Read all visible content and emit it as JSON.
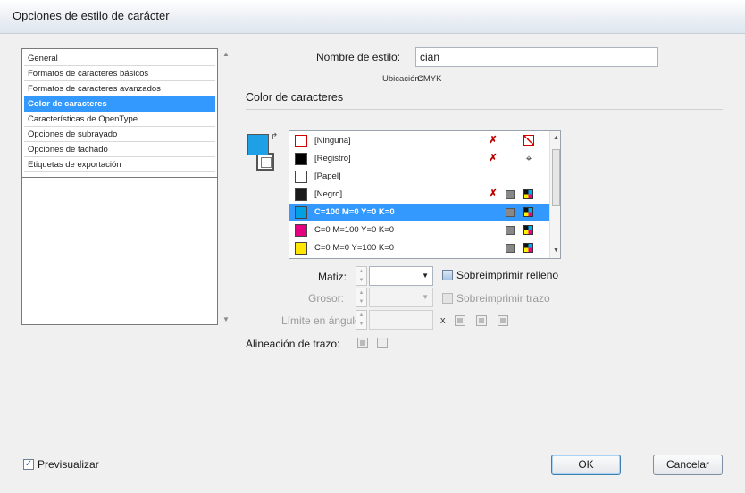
{
  "window": {
    "title": "Opciones de estilo de carácter"
  },
  "categories": [
    "General",
    "Formatos de caracteres básicos",
    "Formatos de caracteres avanzados",
    "Color de caracteres",
    "Características de OpenType",
    "Opciones de subrayado",
    "Opciones de tachado",
    "Etiquetas de exportación"
  ],
  "selected_category": "Color de caracteres",
  "style_name": {
    "label": "Nombre de estilo:",
    "value": "cian"
  },
  "location": {
    "label": "Ubicación:",
    "value": "CMYK"
  },
  "section_title": "Color de caracteres",
  "colors": {
    "fill": "#1ea0e6",
    "selection": "#3399ff"
  },
  "swatches": [
    {
      "name": "[Ninguna]",
      "color": "none",
      "icons": [
        "no-edit-icon",
        "none-icon"
      ]
    },
    {
      "name": "[Registro]",
      "color": "#000000",
      "icons": [
        "no-edit-icon",
        "registration-icon"
      ]
    },
    {
      "name": "[Papel]",
      "color": "#ffffff",
      "icons": []
    },
    {
      "name": "[Negro]",
      "color": "#1a1a1a",
      "icons": [
        "no-edit-icon",
        "process-icon",
        "cmyk-icon"
      ]
    },
    {
      "name": "C=100 M=0 Y=0 K=0",
      "color": "#00a0e3",
      "icons": [
        "process-icon",
        "cmyk-icon"
      ],
      "selected": true
    },
    {
      "name": "C=0 M=100 Y=0 K=0",
      "color": "#e4007f",
      "icons": [
        "process-icon",
        "cmyk-icon"
      ]
    },
    {
      "name": "C=0 M=0 Y=100 K=0",
      "color": "#ffe600",
      "icons": [
        "process-icon",
        "cmyk-icon"
      ]
    }
  ],
  "tint": {
    "label": "Matiz:",
    "value": ""
  },
  "weight": {
    "label": "Grosor:",
    "value": ""
  },
  "miter": {
    "label": "Límite en ángulo:",
    "value": "",
    "x_label": "x"
  },
  "overprint_fill": {
    "label": "Sobreimprimir relleno",
    "checked": false
  },
  "overprint_stroke": {
    "label": "Sobreimprimir trazo",
    "checked": false
  },
  "stroke_alignment": {
    "label": "Alineación de trazo:"
  },
  "preview": {
    "label": "Previsualizar",
    "checked": true
  },
  "buttons": {
    "ok": "OK",
    "cancel": "Cancelar"
  }
}
